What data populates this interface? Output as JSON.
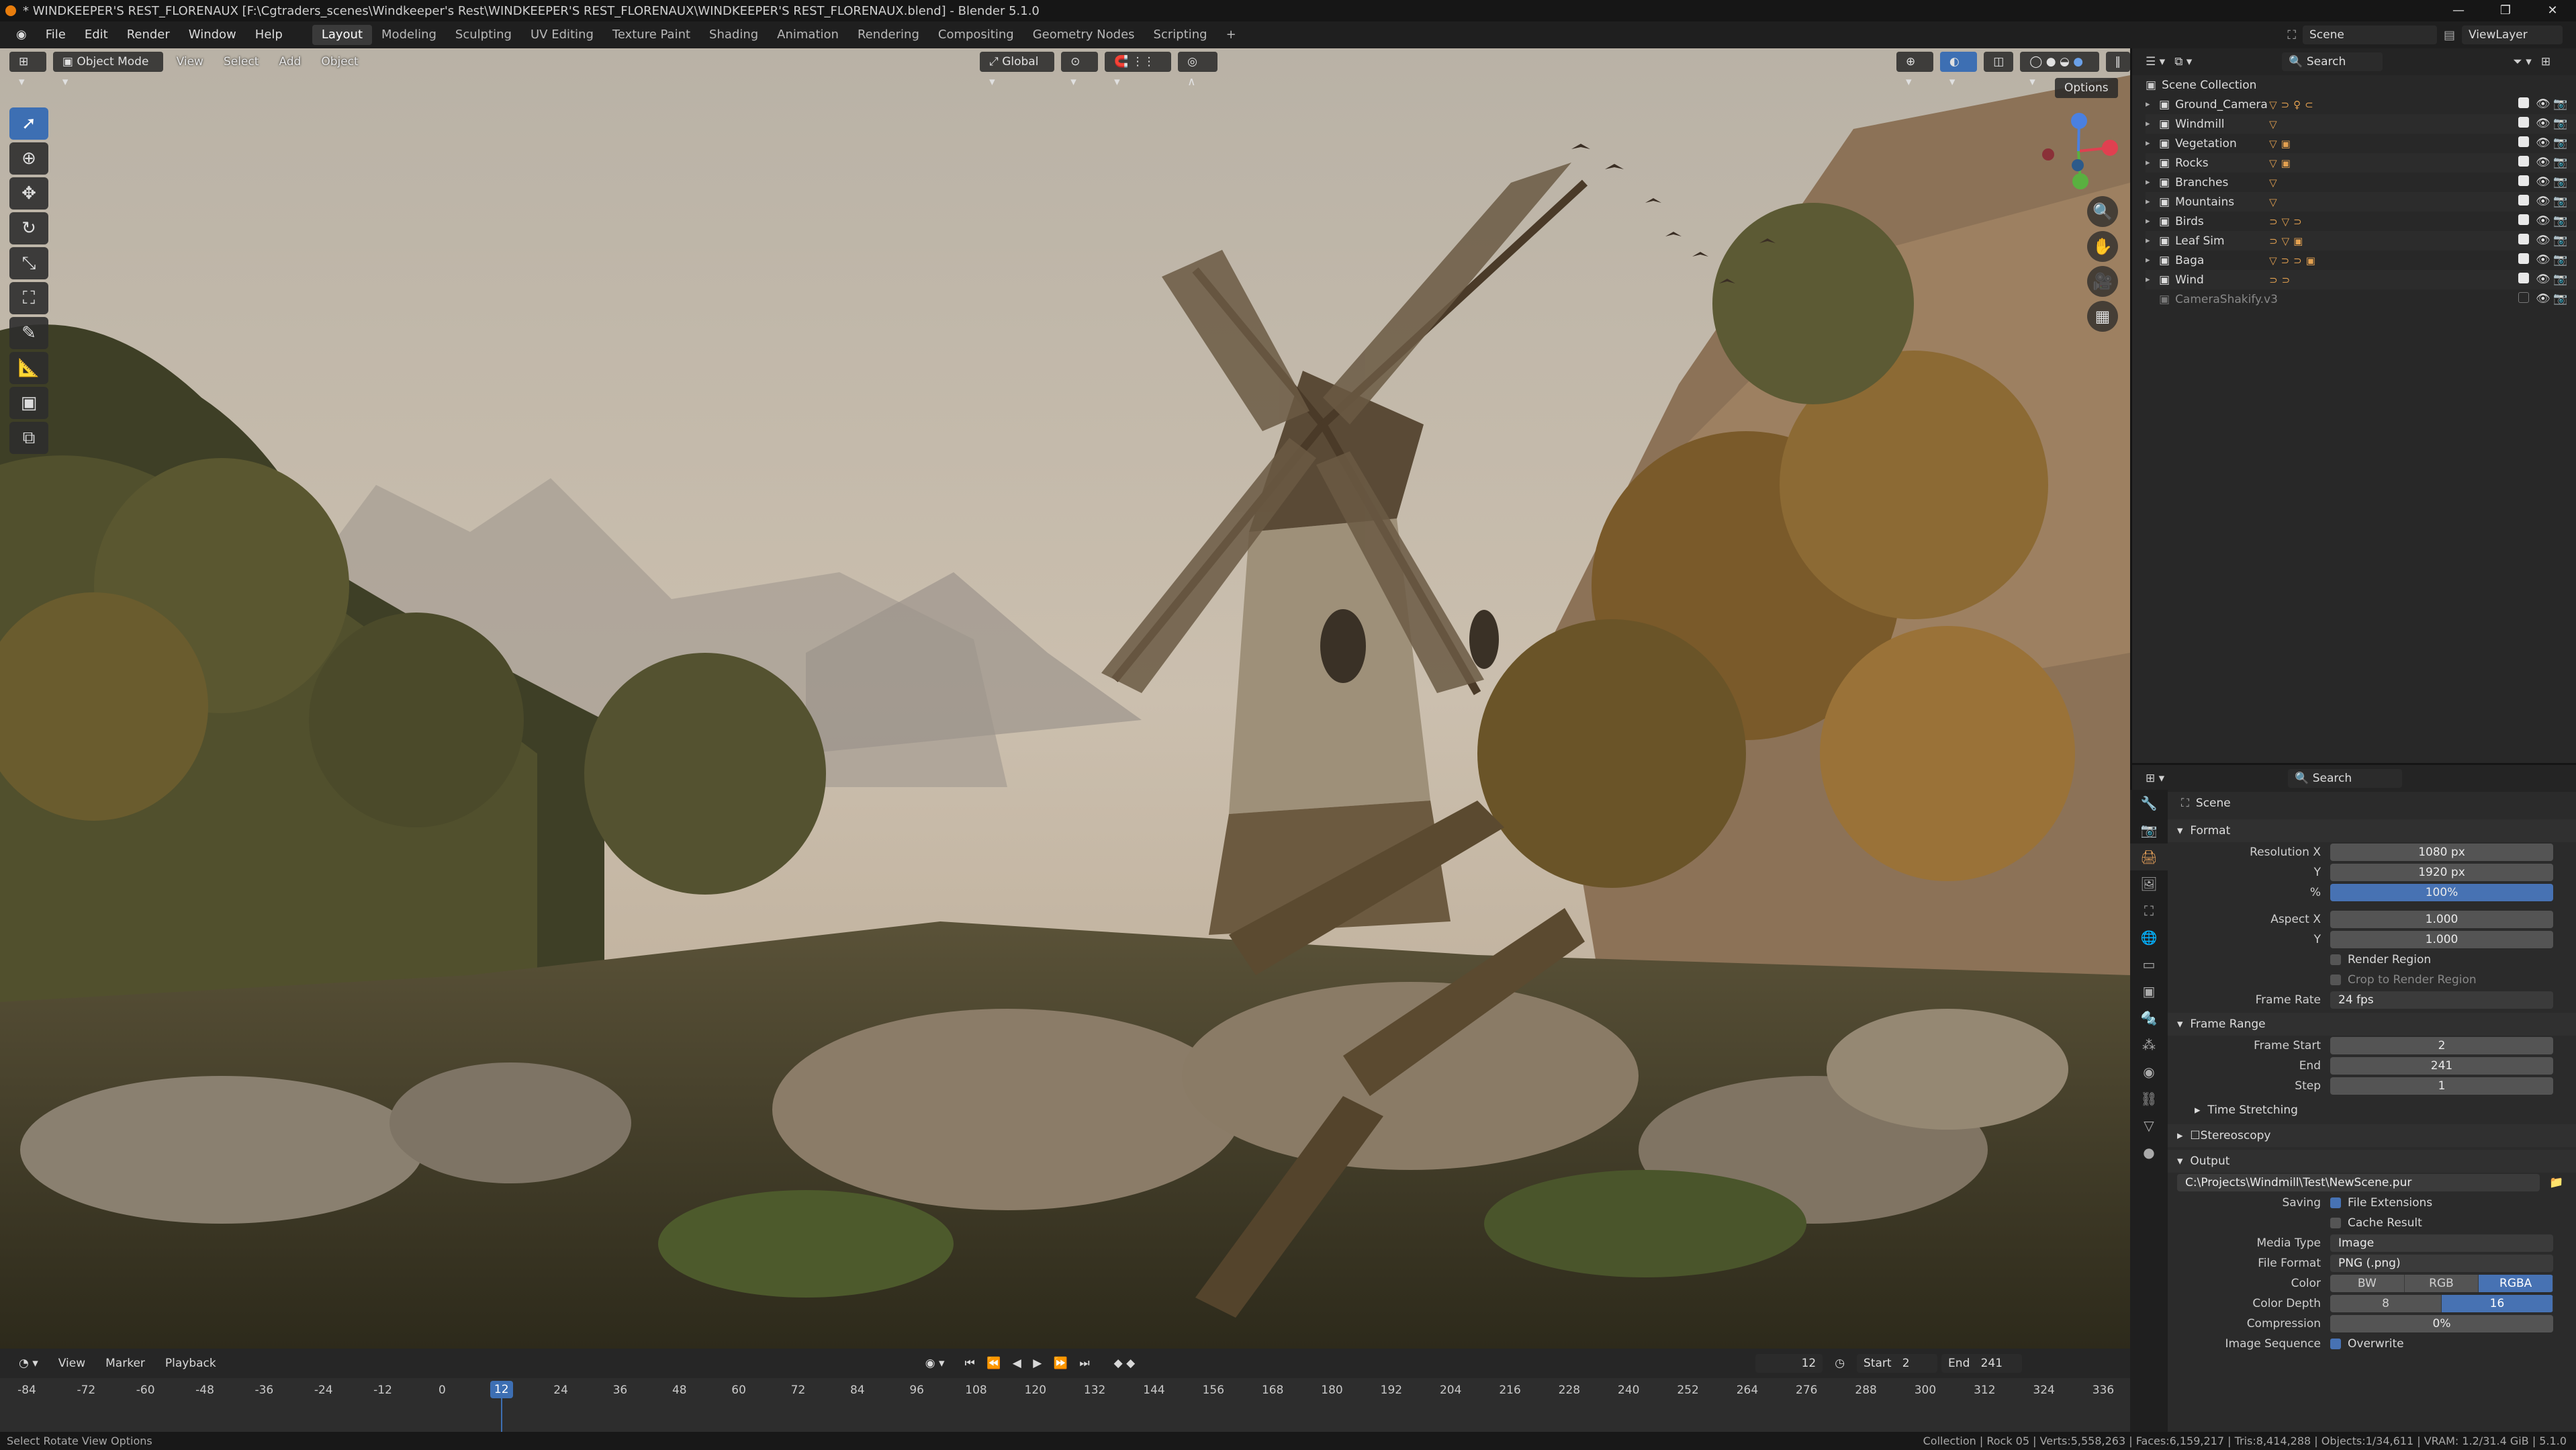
{
  "window": {
    "title": "* WINDKEEPER'S REST_FLORENAUX [F:\\Cgtraders_scenes\\Windkeeper's Rest\\WINDKEEPER'S REST_FLORENAUX\\WINDKEEPER'S REST_FLORENAUX.blend] - Blender 5.1.0",
    "min": "—",
    "max": "❐",
    "close": "✕"
  },
  "menu": {
    "items": [
      "File",
      "Edit",
      "Render",
      "Window",
      "Help"
    ],
    "workspaces": [
      "Layout",
      "Modeling",
      "Sculpting",
      "UV Editing",
      "Texture Paint",
      "Shading",
      "Animation",
      "Rendering",
      "Compositing",
      "Geometry Nodes",
      "Scripting"
    ],
    "add": "+",
    "scene": "Scene",
    "view_layer": "ViewLayer"
  },
  "viewport": {
    "mode": "Object Mode",
    "menus": [
      "View",
      "Select",
      "Add",
      "Object"
    ],
    "transform": "Global",
    "options": "Options"
  },
  "timeline": {
    "menus": [
      "View",
      "Marker",
      "Playback"
    ],
    "current_frame": "12",
    "start_label": "Start",
    "start": "2",
    "end_label": "End",
    "end": "241",
    "ticks": [
      "-84",
      "-72",
      "-60",
      "-48",
      "-36",
      "-24",
      "-12",
      "0",
      "12",
      "24",
      "36",
      "48",
      "60",
      "72",
      "84",
      "96",
      "108",
      "120",
      "132",
      "144",
      "156",
      "168",
      "180",
      "192",
      "204",
      "216",
      "228",
      "240",
      "252",
      "264",
      "276",
      "288",
      "300",
      "312",
      "324",
      "336"
    ]
  },
  "status": {
    "left": "Select     Rotate View     Options",
    "right": "Collection | Rock 05 | Verts:5,558,263 | Faces:6,159,217 | Tris:8,414,288 | Objects:1/34,611 | VRAM: 1.2/31.4 GiB | 5.1.0"
  },
  "outliner": {
    "search": "Search",
    "root": "Scene Collection",
    "items": [
      {
        "name": "Ground_Camera",
        "icons": "▽⊃♀⊂"
      },
      {
        "name": "Windmill",
        "icons": "▽"
      },
      {
        "name": "Vegetation",
        "icons": "▽▣"
      },
      {
        "name": "Rocks",
        "icons": "▽▣"
      },
      {
        "name": "Branches",
        "icons": "▽"
      },
      {
        "name": "Mountains",
        "icons": "▽"
      },
      {
        "name": "Birds",
        "icons": "⊃▽⊃"
      },
      {
        "name": "Leaf Sim",
        "icons": "⊃▽▣"
      },
      {
        "name": "Baga",
        "icons": "▽⊃⊃▣"
      },
      {
        "name": "Wind",
        "icons": "⊃⊃"
      },
      {
        "name": "CameraShakify.v3",
        "icons": ""
      }
    ]
  },
  "properties": {
    "search": "Search",
    "context": "Scene",
    "format": {
      "title": "Format",
      "res_x_label": "Resolution X",
      "res_x": "1080 px",
      "res_y_label": "Y",
      "res_y": "1920 px",
      "pct_label": "%",
      "pct": "100%",
      "aspect_x_label": "Aspect X",
      "aspect_x": "1.000",
      "aspect_y_label": "Y",
      "aspect_y": "1.000",
      "render_region": "Render Region",
      "crop": "Crop to Render Region",
      "fps_label": "Frame Rate",
      "fps": "24 fps"
    },
    "frame_range": {
      "title": "Frame Range",
      "start_label": "Frame Start",
      "start": "2",
      "end_label": "End",
      "end": "241",
      "step_label": "Step",
      "step": "1",
      "time_stretching": "Time Stretching"
    },
    "stereo": "Stereoscopy",
    "output": {
      "title": "Output",
      "path": "C:\\Projects\\Windmill\\Test\\NewScene.pur",
      "saving_label": "Saving",
      "file_ext": "File Extensions",
      "cache": "Cache Result",
      "media_label": "Media Type",
      "media": "Image",
      "format_label": "File Format",
      "format": "PNG (.png)",
      "color_label": "Color",
      "color_opts": [
        "BW",
        "RGB",
        "RGBA"
      ],
      "depth_label": "Color Depth",
      "depth_opts": [
        "8",
        "16"
      ],
      "comp_label": "Compression",
      "comp": "0%",
      "seq_label": "Image Sequence",
      "overwrite": "Overwrite"
    }
  }
}
